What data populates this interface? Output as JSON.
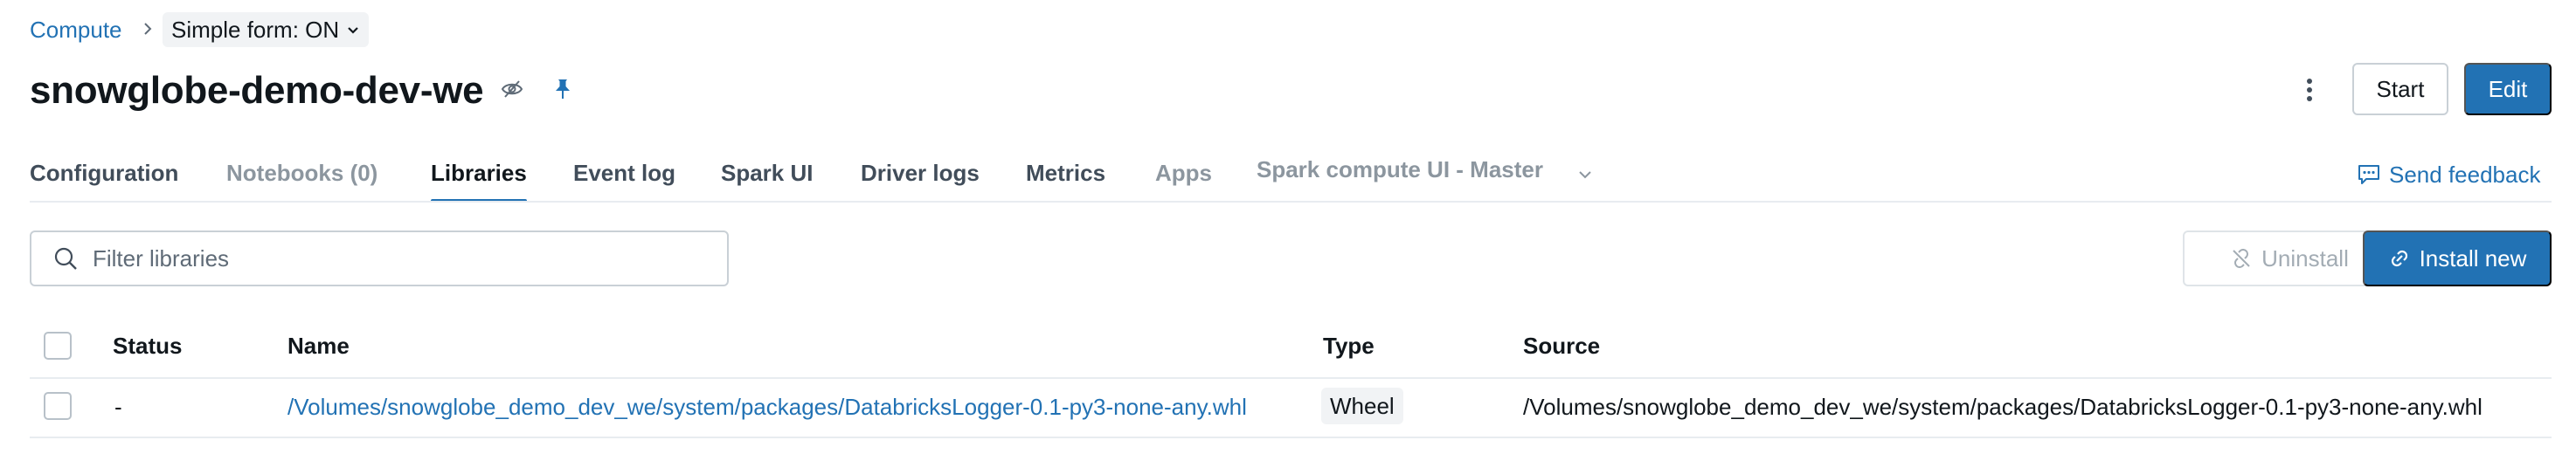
{
  "breadcrumb": {
    "root": "Compute",
    "simple_form": "Simple form: ON"
  },
  "title": "snowglobe-demo-dev-we",
  "actions": {
    "start": "Start",
    "edit": "Edit"
  },
  "tabs": [
    {
      "label": "Configuration",
      "state": "normal"
    },
    {
      "label": "Notebooks (0)",
      "state": "disabled"
    },
    {
      "label": "Libraries",
      "state": "active"
    },
    {
      "label": "Event log",
      "state": "normal"
    },
    {
      "label": "Spark UI",
      "state": "normal"
    },
    {
      "label": "Driver logs",
      "state": "normal"
    },
    {
      "label": "Metrics",
      "state": "normal"
    },
    {
      "label": "Apps",
      "state": "disabled"
    },
    {
      "label": "Spark compute UI - Master",
      "state": "disabled"
    }
  ],
  "feedback": "Send feedback",
  "search": {
    "placeholder": "Filter libraries",
    "value": ""
  },
  "toolbar": {
    "uninstall": "Uninstall",
    "install": "Install new"
  },
  "table": {
    "columns": [
      "Status",
      "Name",
      "Type",
      "Source"
    ],
    "rows": [
      {
        "status": "-",
        "name": "/Volumes/snowglobe_demo_dev_we/system/packages/DatabricksLogger-0.1-py3-none-any.whl",
        "type": "Wheel",
        "source": "/Volumes/snowglobe_demo_dev_we/system/packages/DatabricksLogger-0.1-py3-none-any.whl"
      }
    ]
  },
  "colors": {
    "accent": "#2272b4",
    "text": "#11171c",
    "muted": "#8c969f"
  },
  "icons": {
    "breadcrumb_sep": "chevron-right-icon",
    "simple_form": "chevron-down-icon",
    "title_status": "eye-off-icon",
    "title_pin": "pin-icon",
    "more": "kebab-icon",
    "feedback": "chat-icon",
    "search": "search-icon",
    "uninstall": "unlink-icon",
    "install": "link-icon"
  }
}
